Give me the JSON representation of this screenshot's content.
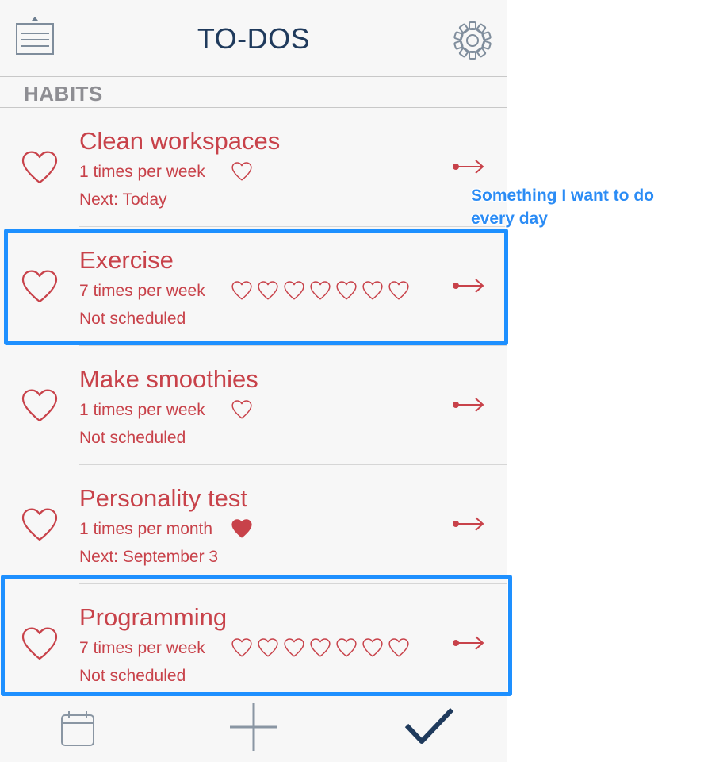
{
  "header": {
    "title": "TO-DOS"
  },
  "section": {
    "title": "HABITS"
  },
  "habits": [
    {
      "title": "Clean workspaces",
      "frequency": "1 times per week",
      "next": "Next: Today",
      "tally_total": 1,
      "tally_done": 0
    },
    {
      "title": "Exercise",
      "frequency": "7 times per week",
      "next": "Not scheduled",
      "tally_total": 7,
      "tally_done": 0
    },
    {
      "title": "Make smoothies",
      "frequency": "1 times per week",
      "next": "Not scheduled",
      "tally_total": 1,
      "tally_done": 0
    },
    {
      "title": "Personality test",
      "frequency": "1 times per month",
      "next": "Next: September 3",
      "tally_total": 1,
      "tally_done": 1
    },
    {
      "title": "Programming",
      "frequency": "7 times per week",
      "next": "Not scheduled",
      "tally_total": 7,
      "tally_done": 0
    }
  ],
  "annotation": {
    "text": "Something I want to do every day"
  },
  "icons": {
    "menu": "menu-icon",
    "settings": "gear-icon",
    "row_heart": "heart-outline-icon",
    "tally_heart": "heart-icon",
    "row_arrow": "arrow-right-icon",
    "calendar": "calendar-icon",
    "add": "plus-icon",
    "done": "checkmark-icon"
  },
  "colors": {
    "accent": "#c8424a",
    "title": "#1f3a5c",
    "section": "#8e8e93",
    "highlight": "#1e90ff",
    "icon_gray": "#8a96a3"
  }
}
